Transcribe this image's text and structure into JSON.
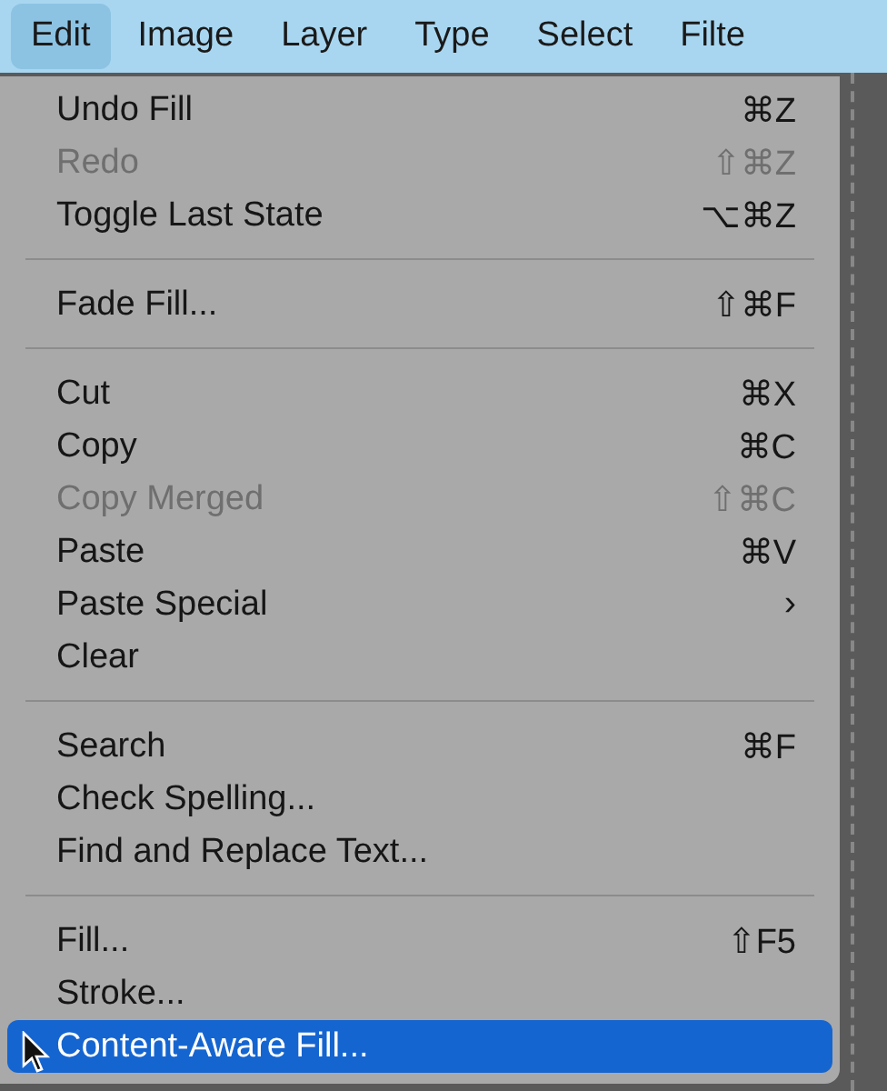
{
  "menu_bar": [
    {
      "label": "Edit",
      "selected": true
    },
    {
      "label": "Image",
      "selected": false
    },
    {
      "label": "Layer",
      "selected": false
    },
    {
      "label": "Type",
      "selected": false
    },
    {
      "label": "Select",
      "selected": false
    },
    {
      "label": "Filte",
      "selected": false
    }
  ],
  "menu": {
    "sections": [
      {
        "items": [
          {
            "label": "Undo Fill",
            "shortcut": "⌘Z",
            "disabled": false,
            "selected": false
          },
          {
            "label": "Redo",
            "shortcut": "⇧⌘Z",
            "disabled": true,
            "selected": false
          },
          {
            "label": "Toggle Last State",
            "shortcut": "⌥⌘Z",
            "disabled": false,
            "selected": false
          }
        ]
      },
      {
        "items": [
          {
            "label": "Fade Fill...",
            "shortcut": "⇧⌘F",
            "disabled": false,
            "selected": false
          }
        ]
      },
      {
        "items": [
          {
            "label": "Cut",
            "shortcut": "⌘X",
            "disabled": false,
            "selected": false
          },
          {
            "label": "Copy",
            "shortcut": "⌘C",
            "disabled": false,
            "selected": false
          },
          {
            "label": "Copy Merged",
            "shortcut": "⇧⌘C",
            "disabled": true,
            "selected": false
          },
          {
            "label": "Paste",
            "shortcut": "⌘V",
            "disabled": false,
            "selected": false
          },
          {
            "label": "Paste Special",
            "submenu_arrow": "›",
            "disabled": false,
            "selected": false
          },
          {
            "label": "Clear",
            "disabled": false,
            "selected": false
          }
        ]
      },
      {
        "items": [
          {
            "label": "Search",
            "shortcut": "⌘F",
            "disabled": false,
            "selected": false
          },
          {
            "label": "Check Spelling...",
            "disabled": false,
            "selected": false
          },
          {
            "label": "Find and Replace Text...",
            "disabled": false,
            "selected": false
          }
        ]
      },
      {
        "items": [
          {
            "label": "Fill...",
            "shortcut": "⇧F5",
            "disabled": false,
            "selected": false
          },
          {
            "label": "Stroke...",
            "disabled": false,
            "selected": false
          },
          {
            "label": "Content-Aware Fill...",
            "disabled": false,
            "selected": true
          }
        ]
      }
    ]
  }
}
